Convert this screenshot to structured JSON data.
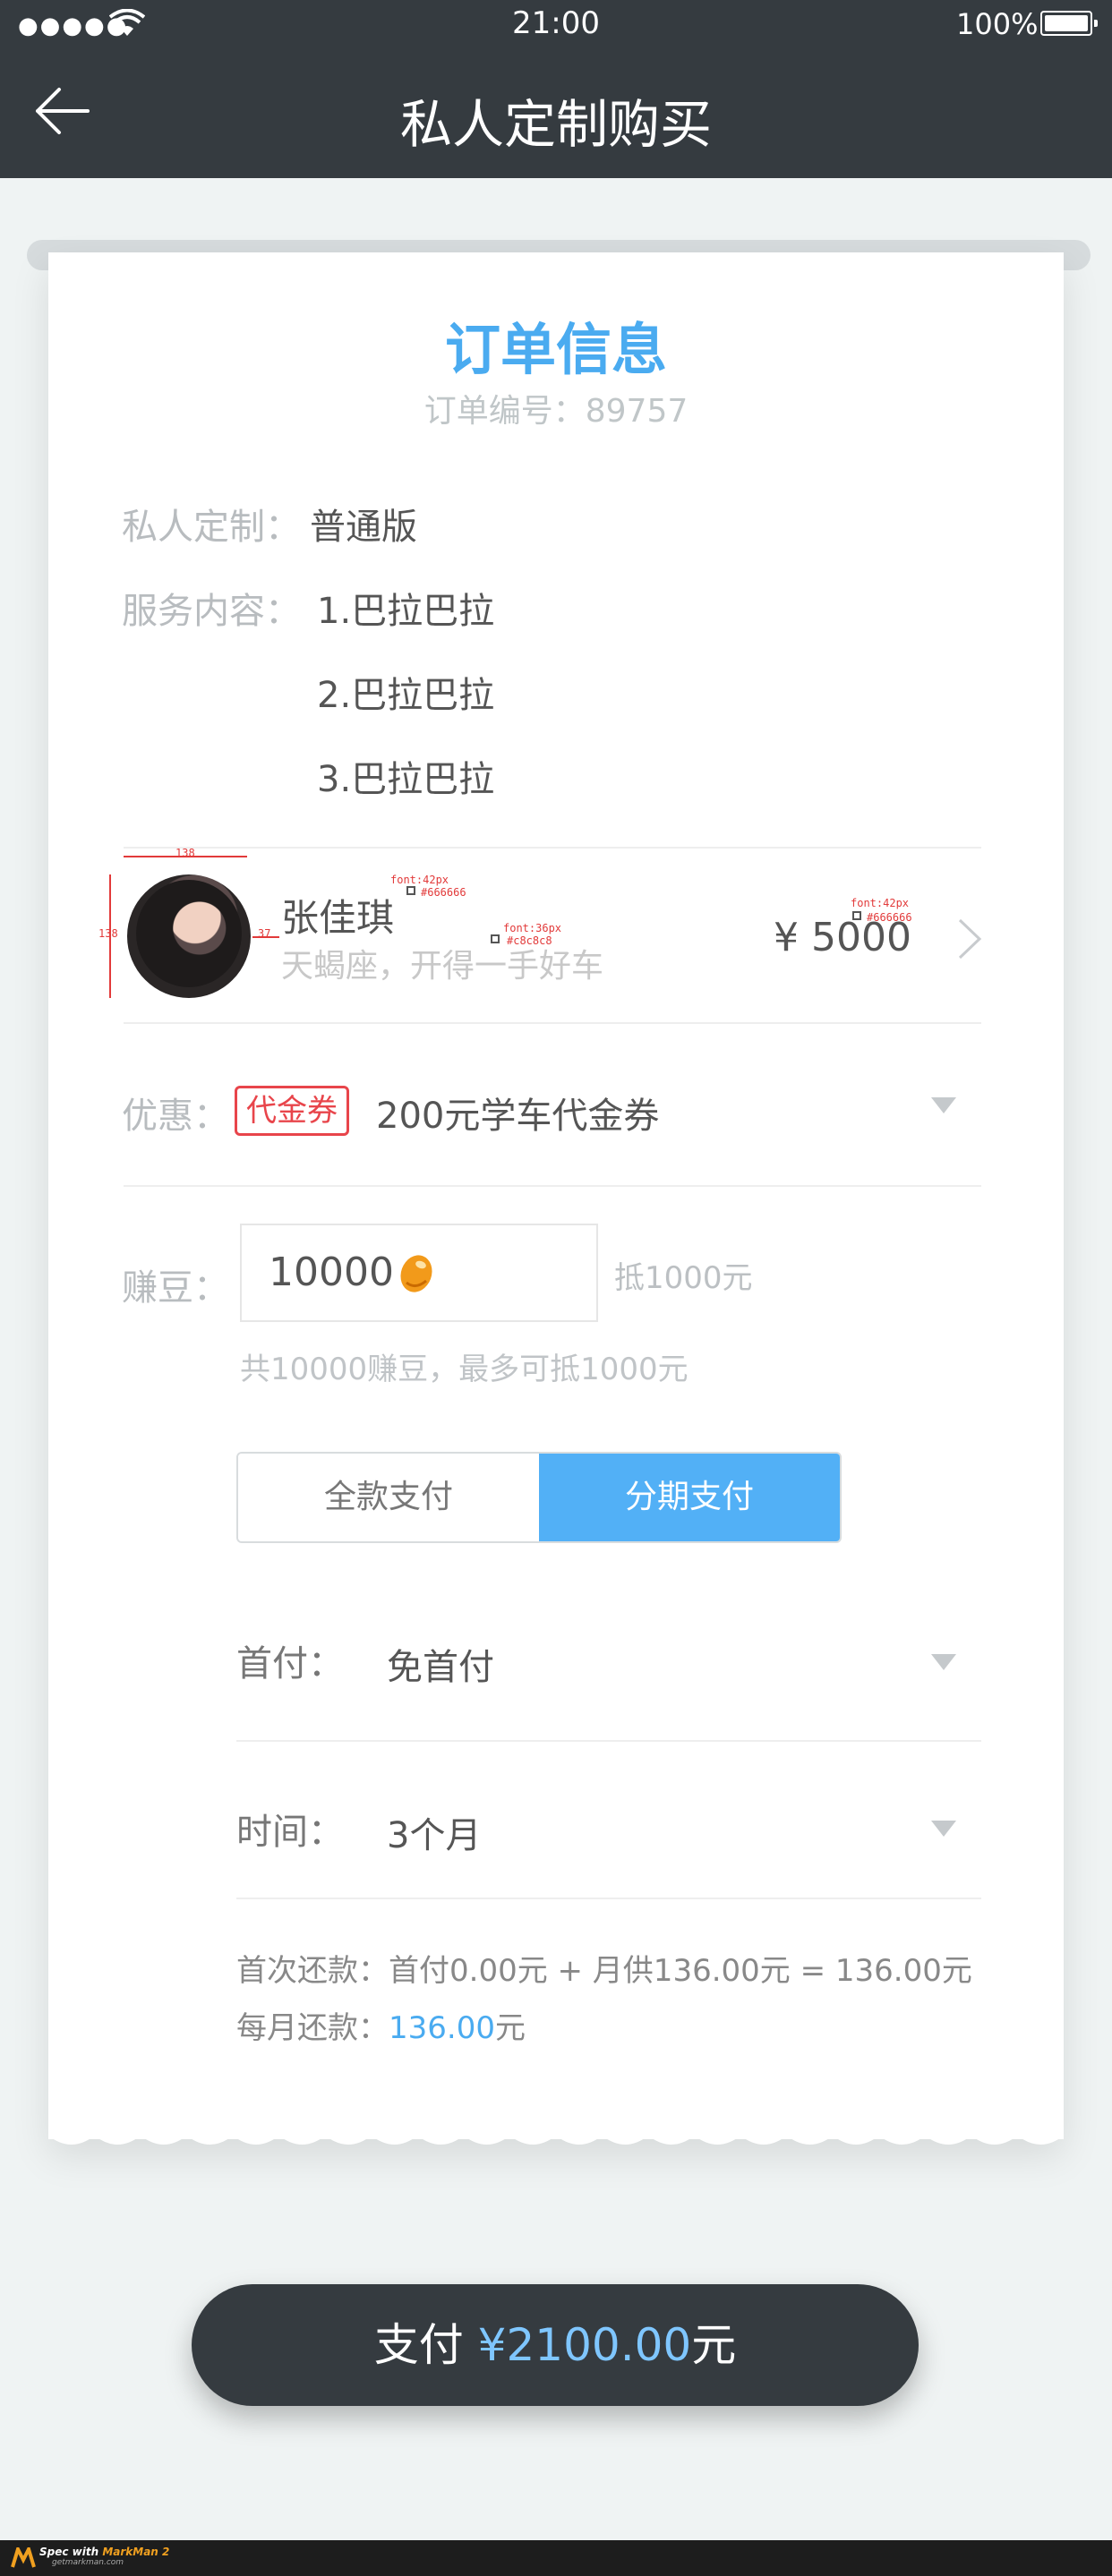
{
  "status_bar": {
    "signal": "●●●●●",
    "time": "21:00",
    "battery": "100%"
  },
  "nav": {
    "title": "私人定制购买"
  },
  "order": {
    "title": "订单信息",
    "number": "订单编号：89757"
  },
  "plan": {
    "label": "私人定制：",
    "value": "普通版"
  },
  "service": {
    "label": "服务内容：",
    "items": [
      "1.巴拉巴拉",
      "2.巴拉巴拉",
      "3.巴拉巴拉"
    ]
  },
  "user": {
    "name": "张佳琪",
    "description": "天蝎座，开得一手好车",
    "price": "¥ 5000"
  },
  "annotations": {
    "avatar_width": "138",
    "avatar_height": "138",
    "gap": "37",
    "name_font": "font:42px",
    "name_color": "#666666",
    "desc_font": "font:36px",
    "desc_color": "#c8c8c8",
    "price_font": "font:42px",
    "price_color": "#666666"
  },
  "coupon": {
    "label": "优惠：",
    "badge": "代金券",
    "value": "200元学车代金券"
  },
  "beans": {
    "label": "赚豆：",
    "value": "10000",
    "deduct": "抵1000元",
    "hint": "共10000赚豆，最多可抵1000元"
  },
  "payment_mode": {
    "full": "全款支付",
    "installment": "分期支付",
    "selected": "installment"
  },
  "down_payment": {
    "label": "首付：",
    "value": "免首付"
  },
  "term": {
    "label": "时间：",
    "value": "3个月"
  },
  "summary": {
    "first_line": "首次还款：首付0.00元 + 月供136.00元 = 136.00元",
    "monthly_prefix": "每月还款：",
    "monthly_amount": "136.00",
    "monthly_suffix": "元"
  },
  "pay_button": {
    "prefix": "支付",
    "amount": "¥2100.00",
    "suffix": "元"
  },
  "footer": {
    "spec_with": "Spec with ",
    "brand": "MarkMan 2",
    "site": "getmarkman.com"
  },
  "colors": {
    "nav_bg": "#353b40",
    "accent_blue": "#4aabf0",
    "toggle_active": "#52b0f6",
    "coupon_red": "#e8454b",
    "page_bg": "#eff3f3"
  }
}
